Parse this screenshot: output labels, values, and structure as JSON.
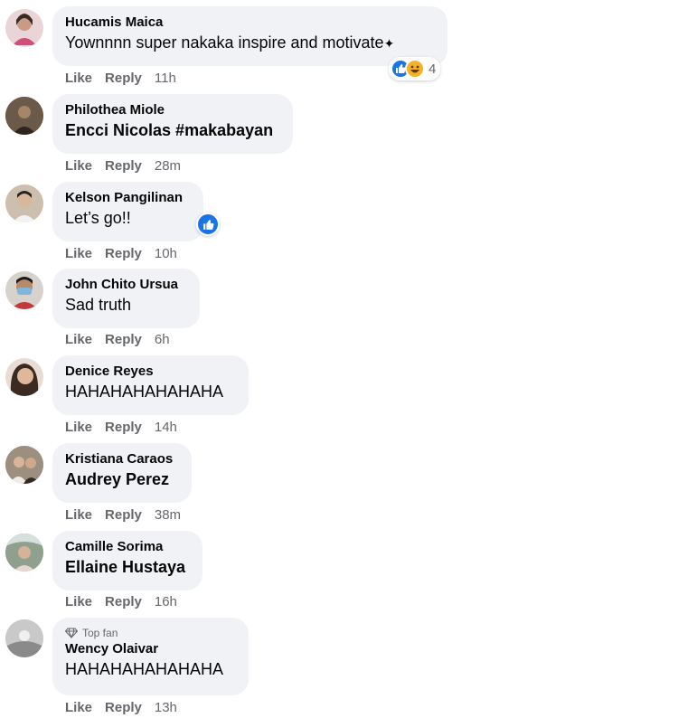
{
  "actions": {
    "like": "Like",
    "reply": "Reply"
  },
  "colors": {
    "bubble": "#f0f2f5",
    "meta": "#65676b",
    "like_blue": "#1b74e4",
    "haha_yellow": "#f7b125"
  },
  "comments": [
    {
      "author": "Hucamis Maica",
      "text": "Yownnnn super nakaka inspire and motivate",
      "time": "11h",
      "reaction_count": "4",
      "reactions": [
        "like-icon",
        "haha-icon"
      ]
    },
    {
      "author": "Philothea Miole",
      "text": "Encci Nicolas #makabayan",
      "time": "28m"
    },
    {
      "author": "Kelson Pangilinan",
      "text": "Let’s go!!",
      "time": "10h",
      "reactions": [
        "like-icon"
      ]
    },
    {
      "author": "John Chito Ursua",
      "text": "Sad truth",
      "time": "6h"
    },
    {
      "author": "Denice Reyes",
      "text": "HAHAHAHAHAHAHA",
      "time": "14h"
    },
    {
      "author": "Kristiana Caraos",
      "text": "Audrey Perez",
      "time": "38m"
    },
    {
      "author": "Camille Sorima",
      "text": "Ellaine Hustaya",
      "time": "16h"
    },
    {
      "author": "Wency Olaivar",
      "badge": "Top fan",
      "text": "HAHAHAHAHAHAHA",
      "time": "13h"
    }
  ]
}
